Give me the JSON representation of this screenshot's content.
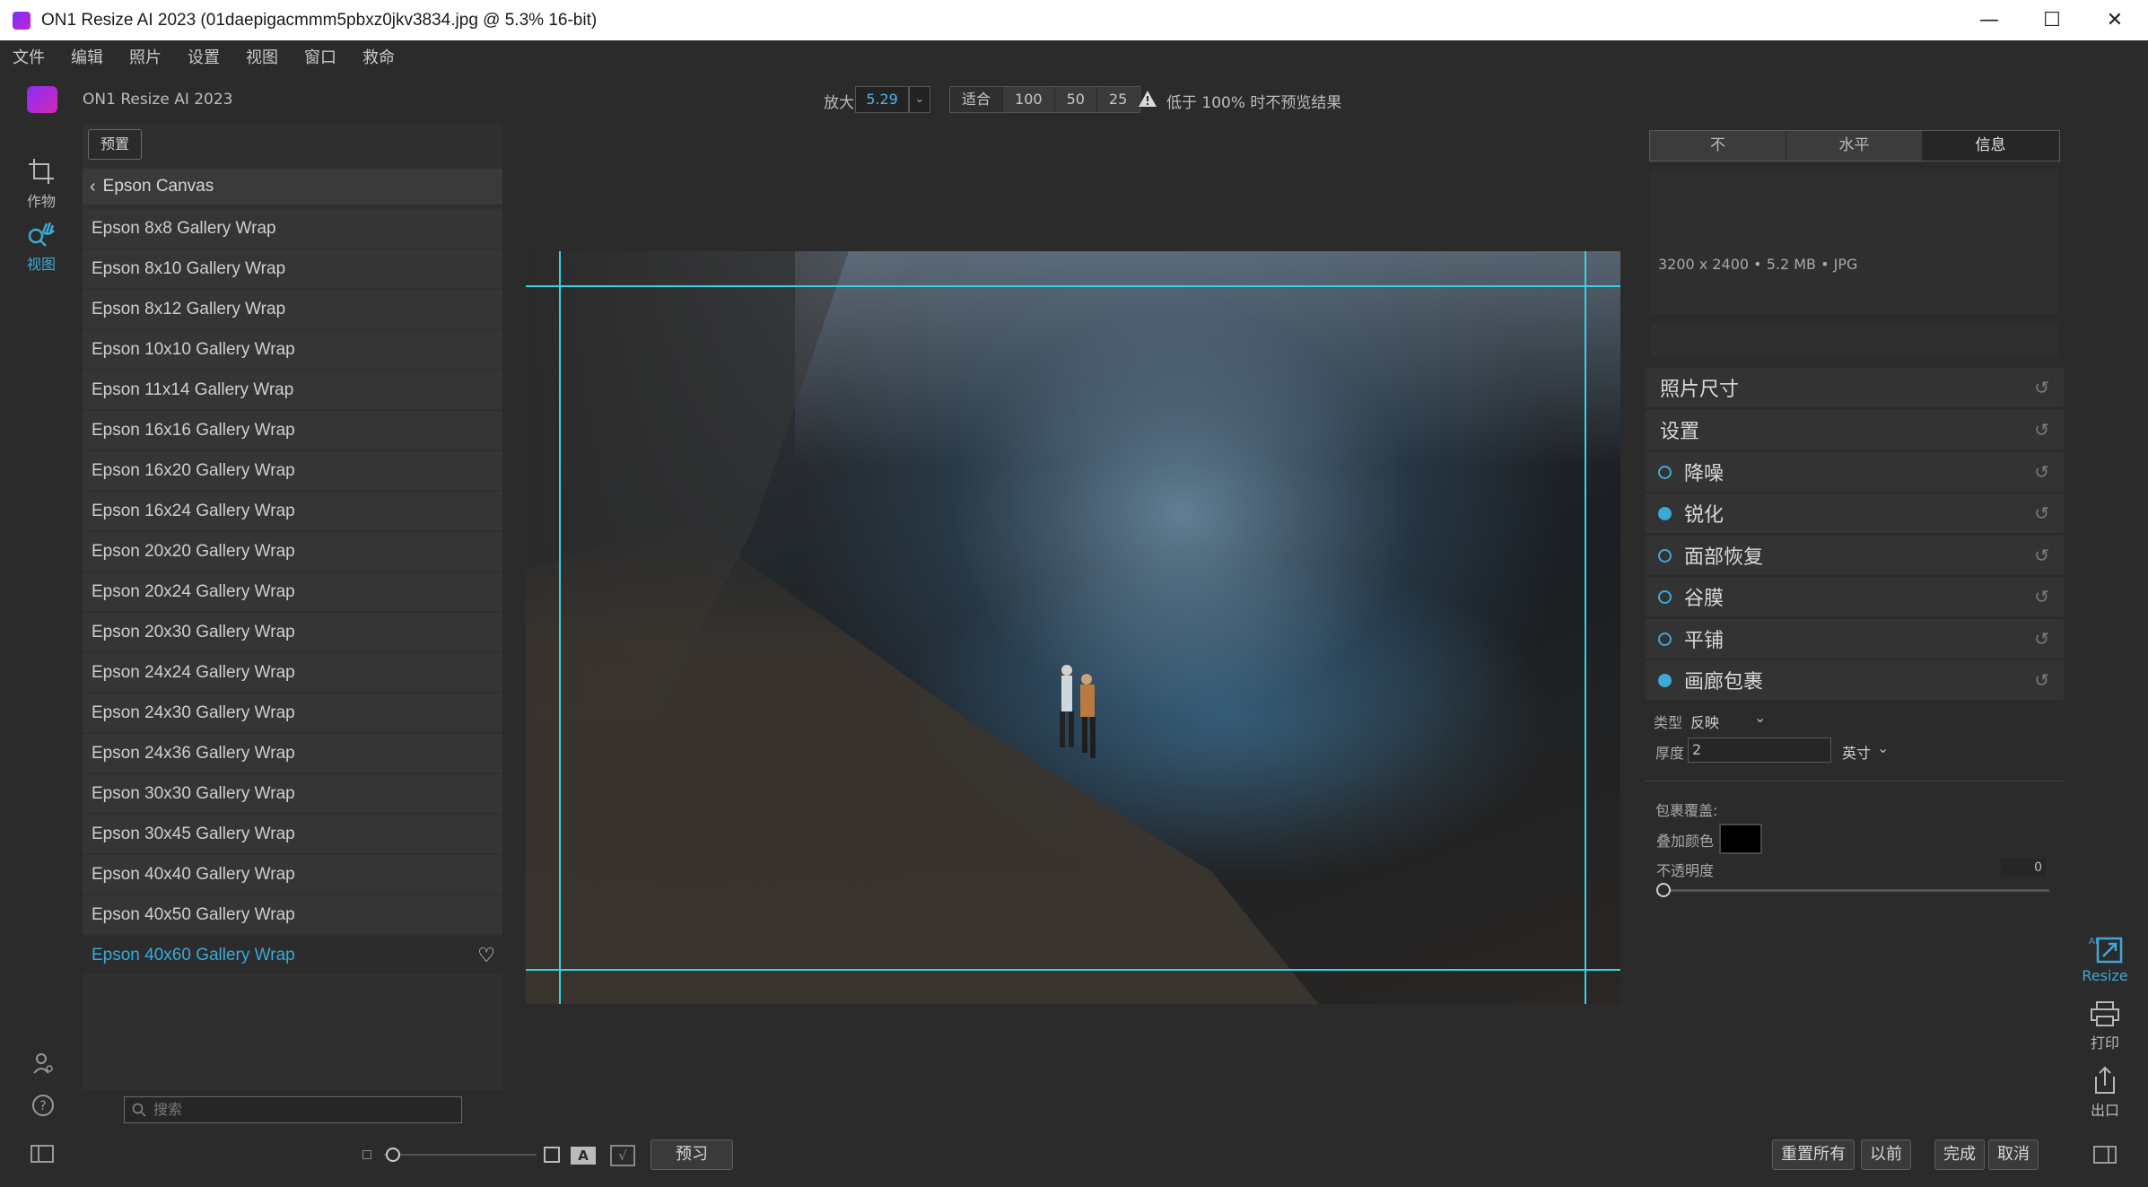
{
  "window": {
    "title": "ON1 Resize AI 2023 (01daepigacmmm5pbxz0jkv3834.jpg @ 5.3% 16-bit)",
    "minimize": "—",
    "maximize": "☐",
    "close": "✕"
  },
  "menu": [
    "文件",
    "编辑",
    "照片",
    "设置",
    "视图",
    "窗口",
    "救命"
  ],
  "toolbar": {
    "app_name": "ON1 Resize AI 2023",
    "zoom_label": "放大",
    "zoom_value": "5.29",
    "zoom_presets": [
      "适合",
      "100",
      "50",
      "25"
    ],
    "warning": "低于 100% 时不预览结果"
  },
  "left_rail": {
    "crop_label": "作物",
    "view_label": "视图"
  },
  "presets": {
    "button": "预置",
    "breadcrumb": "Epson Canvas",
    "items": [
      "Epson 8x8 Gallery Wrap",
      "Epson 8x10 Gallery Wrap",
      "Epson 8x12 Gallery Wrap",
      "Epson 10x10 Gallery Wrap",
      "Epson 11x14 Gallery Wrap",
      "Epson 16x16 Gallery Wrap",
      "Epson 16x20 Gallery Wrap",
      "Epson 16x24 Gallery Wrap",
      "Epson 20x20 Gallery Wrap",
      "Epson 20x24 Gallery Wrap",
      "Epson 20x30 Gallery Wrap",
      "Epson 24x24 Gallery Wrap",
      "Epson 24x30 Gallery Wrap",
      "Epson 24x36 Gallery Wrap",
      "Epson 30x30 Gallery Wrap",
      "Epson 30x45 Gallery Wrap",
      "Epson 40x40 Gallery Wrap",
      "Epson 40x50 Gallery Wrap",
      "Epson 40x60 Gallery Wrap"
    ],
    "selected_index": 18,
    "search_placeholder": "搜索"
  },
  "right_panel": {
    "tabs": [
      "不",
      "水平",
      "信息"
    ],
    "active_tab": 2,
    "info": "3200 x 2400  •  5.2 MB  •  JPG",
    "sections": {
      "photo_size": "照片尺寸",
      "settings": "设置",
      "noise": "降噪",
      "sharpen": "锐化",
      "face": "面部恢复",
      "film_grain": "谷膜",
      "tiling": "平铺",
      "gallery_wrap": "画廊包裹"
    },
    "enabled": {
      "noise": false,
      "sharpen": true,
      "face": false,
      "film_grain": false,
      "tiling": false,
      "gallery_wrap": true
    },
    "wrap": {
      "type_label": "类型",
      "type_value": "反映",
      "thickness_label": "厚度",
      "thickness_value": "2",
      "unit": "英寸",
      "overlay_label": "包裹覆盖:",
      "overlay_color_label": "叠加颜色",
      "overlay_color": "#000000",
      "opacity_label": "不透明度",
      "opacity_value": "0"
    },
    "reset_glyph": "↺"
  },
  "modules": {
    "resize": "Resize",
    "print": "打印",
    "export": "出口"
  },
  "bottom": {
    "preview_button": "预习",
    "reset_all": "重置所有",
    "previous": "以前",
    "done": "完成",
    "cancel": "取消"
  },
  "colors": {
    "accent": "#3ea8d8",
    "guide": "#34d3e0"
  }
}
